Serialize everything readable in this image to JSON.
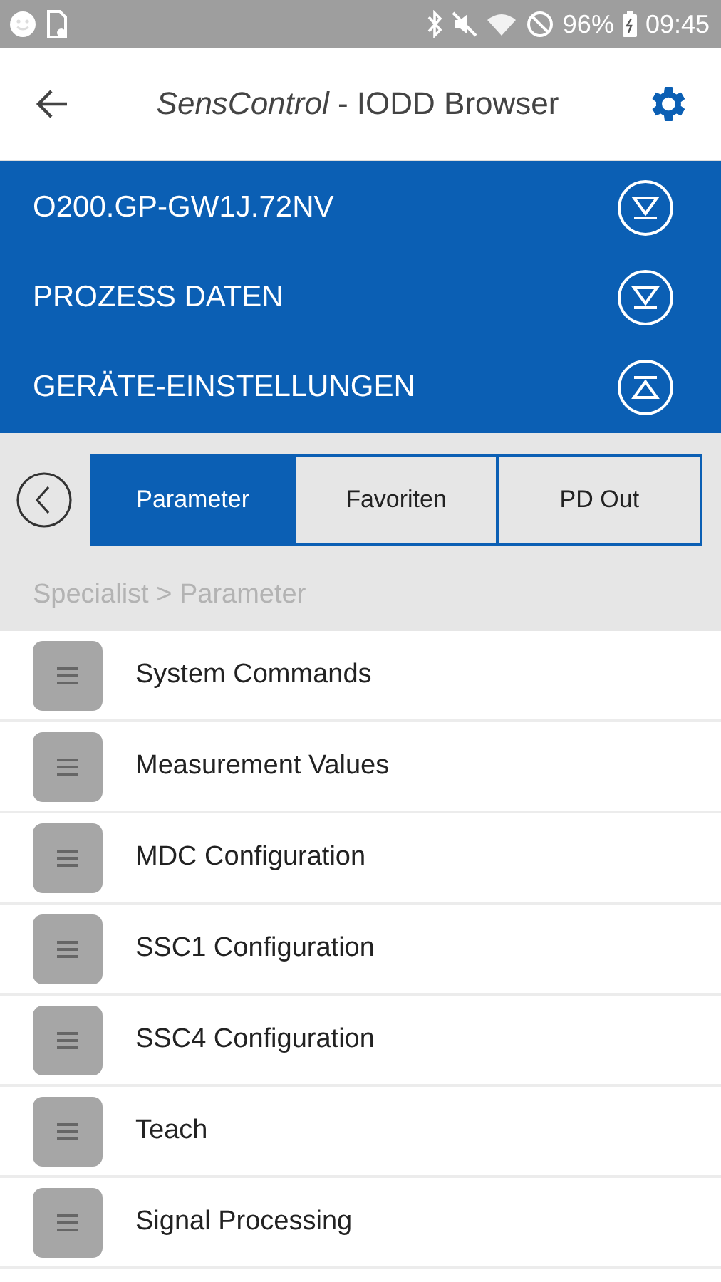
{
  "status_bar": {
    "battery": "96%",
    "time": "09:45"
  },
  "app_bar": {
    "title": "*SensControl* - IODD Browser"
  },
  "sections": [
    {
      "label": "O200.GP-GW1J.72NV",
      "expanded": false
    },
    {
      "label": "PROZESS DATEN",
      "expanded": false
    },
    {
      "label": "GERÄTE-EINSTELLUNGEN",
      "expanded": true
    }
  ],
  "tabs": [
    {
      "label": "Parameter",
      "selected": true
    },
    {
      "label": "Favoriten",
      "selected": false
    },
    {
      "label": "PD Out",
      "selected": false
    }
  ],
  "breadcrumb": "Specialist > Parameter",
  "items": [
    {
      "label": "System Commands"
    },
    {
      "label": "Measurement Values"
    },
    {
      "label": "MDC Configuration"
    },
    {
      "label": "SSC1 Configuration"
    },
    {
      "label": "SSC4 Configuration"
    },
    {
      "label": "Teach"
    },
    {
      "label": "Signal Processing"
    }
  ]
}
